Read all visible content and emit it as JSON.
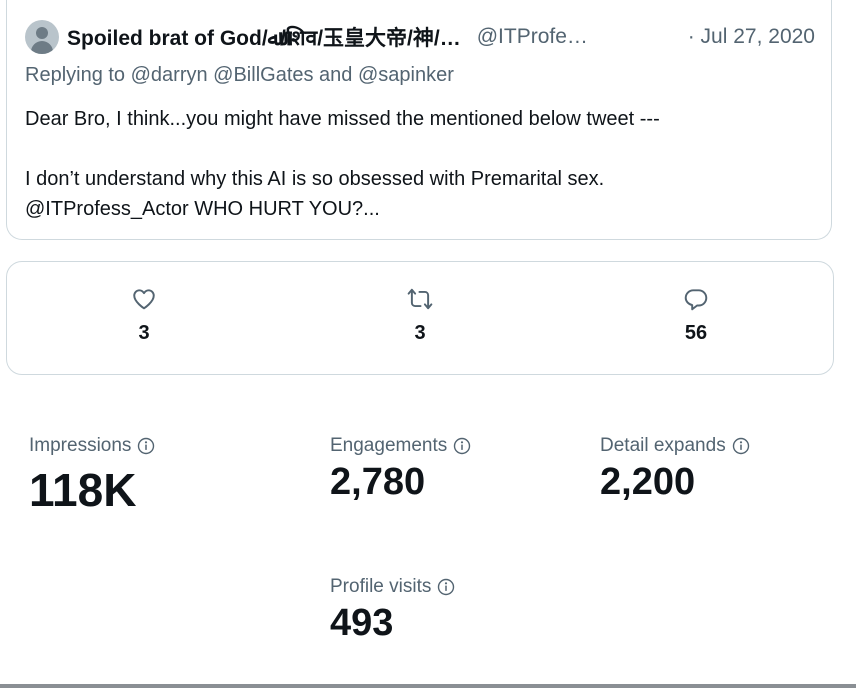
{
  "tweet": {
    "display_name": "Spoiled brat of God/ﷲ/शिव/玉皇大帝/神/…",
    "handle": "@ITProfe…",
    "date": "· Jul 27, 2020",
    "replying_to": "Replying to @darryn @BillGates and @sapinker",
    "body_line1": "Dear Bro, I think...you might have missed the mentioned below tweet ---",
    "body_line2": "I don’t understand why this AI is so obsessed with Premarital sex.",
    "body_line3": "@ITProfess_Actor WHO HURT YOU?..."
  },
  "actions": {
    "likes": "3",
    "retweets": "3",
    "replies": "56"
  },
  "metrics": {
    "impressions_label": "Impressions",
    "impressions_value": "118K",
    "engagements_label": "Engagements",
    "engagements_value": "2,780",
    "detail_expands_label": "Detail expands",
    "detail_expands_value": "2,200",
    "profile_visits_label": "Profile visits",
    "profile_visits_value": "493"
  },
  "icons": [
    "user-avatar-icon",
    "heart-icon",
    "retweet-icon",
    "reply-icon",
    "info-icon"
  ],
  "colors": {
    "text": "#0f1419",
    "secondary": "#536471",
    "border": "#cfd9de"
  }
}
